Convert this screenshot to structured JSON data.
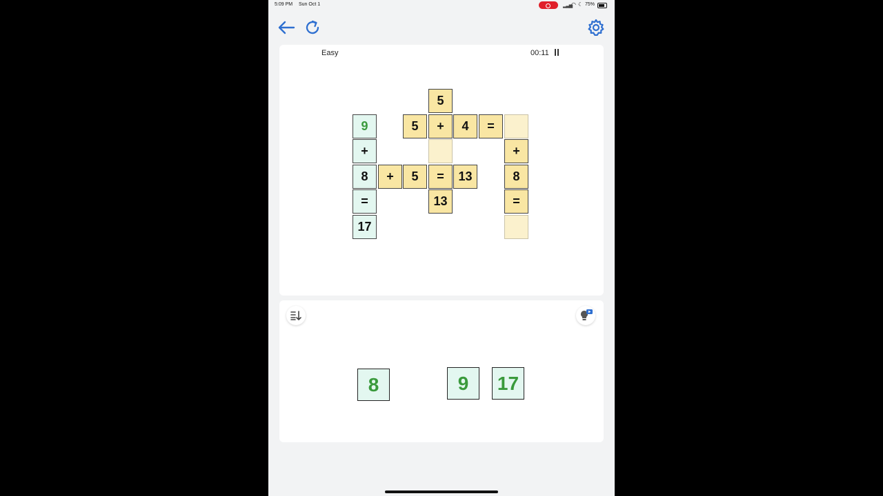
{
  "status_bar": {
    "time": "5:09 PM",
    "date": "Sun Oct 1",
    "battery": "75%"
  },
  "toolbar": {
    "back_icon": "arrow-left-icon",
    "refresh_icon": "refresh-icon",
    "settings_icon": "gear-icon"
  },
  "accent_color": "#2e6fd0",
  "board": {
    "difficulty": "Easy",
    "timer": "00:11",
    "cells": [
      {
        "col": 3,
        "row": 0,
        "value": "5",
        "style": "yellow"
      },
      {
        "col": 0,
        "row": 1,
        "value": "9",
        "style": "green",
        "text": "green"
      },
      {
        "col": 2,
        "row": 1,
        "value": "5",
        "style": "yellow"
      },
      {
        "col": 3,
        "row": 1,
        "value": "+",
        "style": "yellow"
      },
      {
        "col": 4,
        "row": 1,
        "value": "4",
        "style": "yellow"
      },
      {
        "col": 5,
        "row": 1,
        "value": "=",
        "style": "yellow"
      },
      {
        "col": 6,
        "row": 1,
        "value": "",
        "style": "empty"
      },
      {
        "col": 0,
        "row": 2,
        "value": "+",
        "style": "green"
      },
      {
        "col": 3,
        "row": 2,
        "value": "",
        "style": "empty"
      },
      {
        "col": 6,
        "row": 2,
        "value": "+",
        "style": "yellow"
      },
      {
        "col": 0,
        "row": 3,
        "value": "8",
        "style": "green"
      },
      {
        "col": 1,
        "row": 3,
        "value": "+",
        "style": "yellow"
      },
      {
        "col": 2,
        "row": 3,
        "value": "5",
        "style": "yellow"
      },
      {
        "col": 3,
        "row": 3,
        "value": "=",
        "style": "yellow"
      },
      {
        "col": 4,
        "row": 3,
        "value": "13",
        "style": "yellow"
      },
      {
        "col": 6,
        "row": 3,
        "value": "8",
        "style": "yellow"
      },
      {
        "col": 0,
        "row": 4,
        "value": "=",
        "style": "green"
      },
      {
        "col": 3,
        "row": 4,
        "value": "13",
        "style": "yellow"
      },
      {
        "col": 6,
        "row": 4,
        "value": "=",
        "style": "yellow"
      },
      {
        "col": 0,
        "row": 5,
        "value": "17",
        "style": "green"
      },
      {
        "col": 6,
        "row": 5,
        "value": "",
        "style": "empty"
      }
    ]
  },
  "tray": {
    "sort_icon": "sort-icon",
    "hint_icon": "lightbulb-video-icon",
    "tiles": [
      {
        "value": "8"
      },
      {
        "value": "9"
      },
      {
        "value": "17"
      }
    ]
  }
}
